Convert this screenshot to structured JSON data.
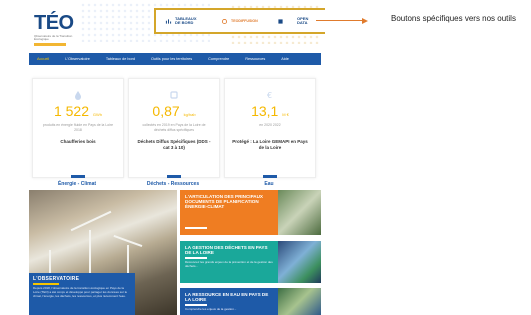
{
  "header": {
    "logo_text": "TÉO",
    "logo_sub": "Observatoire de la Transition Écologique",
    "buttons": [
      {
        "label": "TABLEAUX DE BORD",
        "icon": "dashboard-icon"
      },
      {
        "label": "TeoDIFFUSION",
        "icon": "diffusion-icon"
      },
      {
        "label": "OPEN DATA",
        "icon": "database-icon"
      }
    ]
  },
  "annotation": {
    "text": "Boutons spécifiques vers nos outils"
  },
  "nav": {
    "items": [
      "Accueil",
      "L'Observatoire",
      "Tableaux de bord",
      "Outils pour les territoires",
      "Comprendre",
      "Ressources",
      "Aide"
    ],
    "active_index": 0
  },
  "cards": [
    {
      "icon": "droplet-icon",
      "value": "1 522",
      "unit": "GWh",
      "desc": "produits en énergie fluide en Pays de la Loire 2018",
      "label": "Chaufferies bois"
    },
    {
      "icon": "recycle-icon",
      "value": "0,87",
      "unit": "kg/hab",
      "desc": "collectés en 2019 en Pays de la Loire de déchets diffus spécifiques",
      "label": "Déchets Diffus Spécifiques (DDS - cat 3 à 10)"
    },
    {
      "icon": "euro-icon",
      "value": "13,1",
      "unit": "M €",
      "desc": "en 2020 2022",
      "label": "Protégé : La Loire GEMAPI en Pays de la Loire"
    }
  ],
  "categories": [
    "Énergie - Climat",
    "Déchets - Ressources",
    "Eau"
  ],
  "observatory": {
    "title": "L'OBSERVATOIRE",
    "text": "Depuis 2018, l'observatoire de la transition écologique en Pays de la Loire (TEO) a été conçu et développé pour partager les données sur le climat, l'énergie, les déchets, les ressources, et plus récemment l'eau."
  },
  "panels": [
    {
      "title": "L'ARTICULATION DES PRINCIPAUX DOCUMENTS DE PLANIFICATION ÉNERGIE-CLIMAT",
      "text": "",
      "color": "#ef7d22"
    },
    {
      "title": "LA GESTION DES DÉCHETS EN PAYS DE LA LOIRE",
      "text": "Découvrez les grands enjeux de la prévention et de la gestion des déchets...",
      "color": "#1aa89a"
    },
    {
      "title": "LA RESSOURCE EN EAU EN PAYS DE LA LOIRE",
      "text": "Comprendre les enjeux de la gestion...",
      "color": "#1e5aa8"
    }
  ],
  "colors": {
    "brand_blue": "#1e5aa8",
    "accent_yellow": "#f5b800",
    "highlight_border": "#d4a62a",
    "annotation": "#e07b2d"
  }
}
